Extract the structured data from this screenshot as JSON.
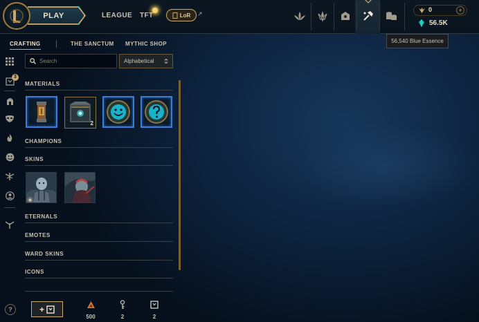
{
  "topbar": {
    "play_label": "PLAY",
    "nav": [
      "LEAGUE",
      "TFT"
    ],
    "lor_label": "LoR",
    "external_glyph": "↗",
    "nav_icons": [
      "home-lotus-icon",
      "champion-mastery-icon",
      "collection-chest-icon",
      "loot-crafting-icon",
      "store-coins-icon"
    ],
    "rp_value": "0",
    "rp_plus": "+",
    "be_value": "56.5K"
  },
  "tooltip": {
    "text": "56,540 Blue Essence"
  },
  "subtabs": [
    "CRAFTING",
    "THE SANCTUM",
    "MYTHIC SHOP"
  ],
  "rail": {
    "badge_count": "3",
    "icons": [
      "grid-icon",
      "chest-icon",
      "helmet-icon",
      "mask-icon",
      "fire-icon",
      "emote-icon",
      "ward-icon",
      "icon-profile-icon",
      "wards-fork-icon"
    ],
    "help_label": "?"
  },
  "search": {
    "placeholder": "Search",
    "value": ""
  },
  "sort": {
    "selected": "Alphabetical",
    "arrow": "⌃⌄"
  },
  "sections": {
    "materials": "MATERIALS",
    "champions": "CHAMPIONS",
    "skins": "SKINS",
    "eternals": "ETERNALS",
    "emotes": "EMOTES",
    "ward_skins": "WARD SKINS",
    "icons": "ICONS"
  },
  "materials": [
    {
      "name": "key-fragment-capsule",
      "count": ""
    },
    {
      "name": "hextech-chest",
      "count": "2"
    },
    {
      "name": "emote-orb",
      "count": ""
    },
    {
      "name": "mystery-orb",
      "count": ""
    }
  ],
  "skins": [
    {
      "name": "skin-shard-1"
    },
    {
      "name": "skin-shard-2"
    }
  ],
  "bottom": {
    "add_label": "+",
    "resources": [
      {
        "icon": "orange-essence-icon",
        "count": "500",
        "color": "#d6792d"
      },
      {
        "icon": "key-icon",
        "count": "2",
        "color": "#c9c3b2"
      },
      {
        "icon": "chest-icon",
        "count": "2",
        "color": "#c9c3b2"
      }
    ]
  },
  "colors": {
    "gold": "#c8aa6e",
    "teal": "#0ac8b9",
    "blue_tile": "#3a7cd6",
    "text": "#c9c3b2"
  }
}
